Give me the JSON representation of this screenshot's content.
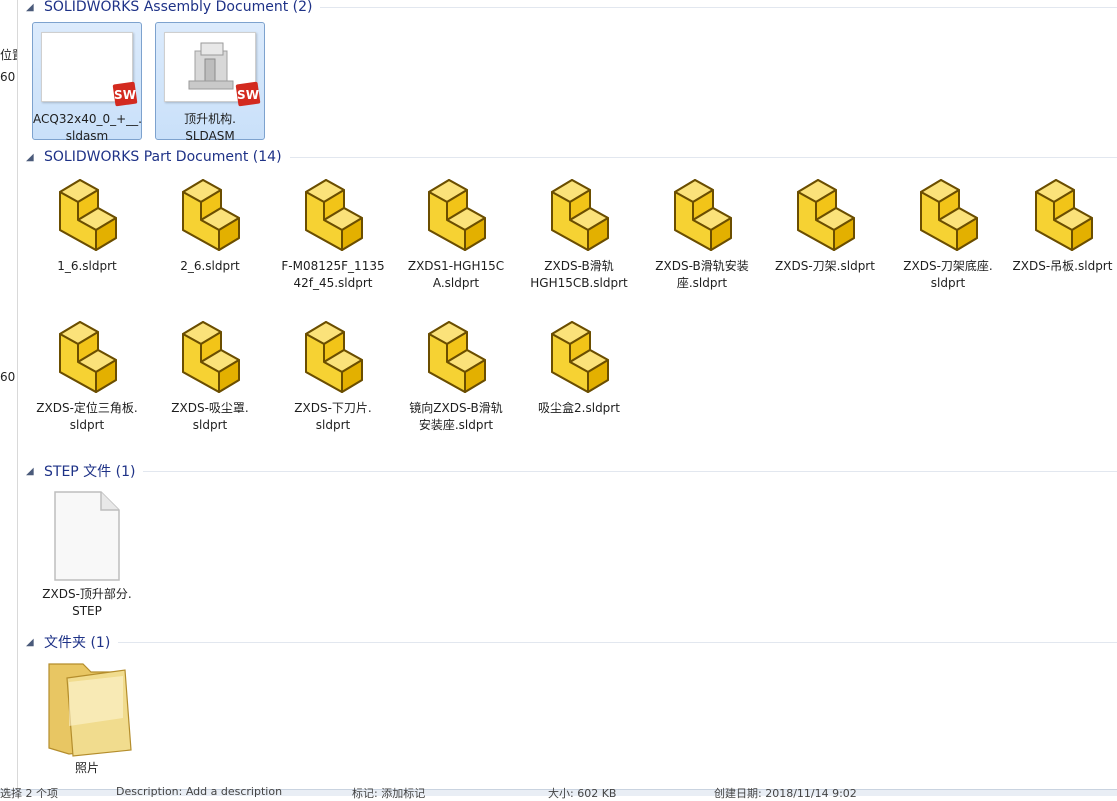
{
  "left_pane": {
    "items": [
      "位置",
      "60",
      "60"
    ]
  },
  "groups": [
    {
      "title": "SOLIDWORKS Assembly Document (2)"
    },
    {
      "title": "SOLIDWORKS Part Document (14)"
    },
    {
      "title": "STEP 文件 (1)"
    },
    {
      "title": "文件夹 (1)"
    }
  ],
  "assemblies": [
    {
      "line1": "ACQ32x40_0_+__.",
      "line2": "sldasm"
    },
    {
      "line1": "顶升机构.",
      "line2": "SLDASM"
    }
  ],
  "parts": [
    {
      "line1": "1_6.sldprt",
      "line2": ""
    },
    {
      "line1": "2_6.sldprt",
      "line2": ""
    },
    {
      "line1": "F-M08125F_1135",
      "line2": "42f_45.sldprt"
    },
    {
      "line1": "ZXDS1-HGH15C",
      "line2": "A.sldprt"
    },
    {
      "line1": "ZXDS-B滑轨",
      "line2": "HGH15CB.sldprt"
    },
    {
      "line1": "ZXDS-B滑轨安装",
      "line2": "座.sldprt"
    },
    {
      "line1": "ZXDS-刀架.sldprt",
      "line2": ""
    },
    {
      "line1": "ZXDS-刀架底座.",
      "line2": "sldprt"
    },
    {
      "line1": "ZXDS-吊板.sldprt",
      "line2": ""
    },
    {
      "line1": "ZXDS-定位三角板.",
      "line2": "sldprt"
    },
    {
      "line1": "ZXDS-吸尘罩.",
      "line2": "sldprt"
    },
    {
      "line1": "ZXDS-下刀片.",
      "line2": "sldprt"
    },
    {
      "line1": "镜向ZXDS-B滑轨",
      "line2": "安装座.sldprt"
    },
    {
      "line1": "吸尘盒2.sldprt",
      "line2": ""
    }
  ],
  "step_files": [
    {
      "line1": "ZXDS-顶升部分.",
      "line2": "STEP"
    }
  ],
  "folders": [
    {
      "line1": "照片",
      "line2": ""
    }
  ],
  "statusbar": {
    "selected": "选择 2 个项",
    "description_label": "Description: Add a description",
    "tags_label": "标记: 添加标记",
    "size_label": "大小: 602 KB",
    "date_label": "创建日期: 2018/11/14 9:02"
  },
  "colors": {
    "accent": "#1e3287",
    "selection_bg": "#cde3fb",
    "selection_border": "#7da2ce",
    "part_icon": "#f2c418"
  }
}
